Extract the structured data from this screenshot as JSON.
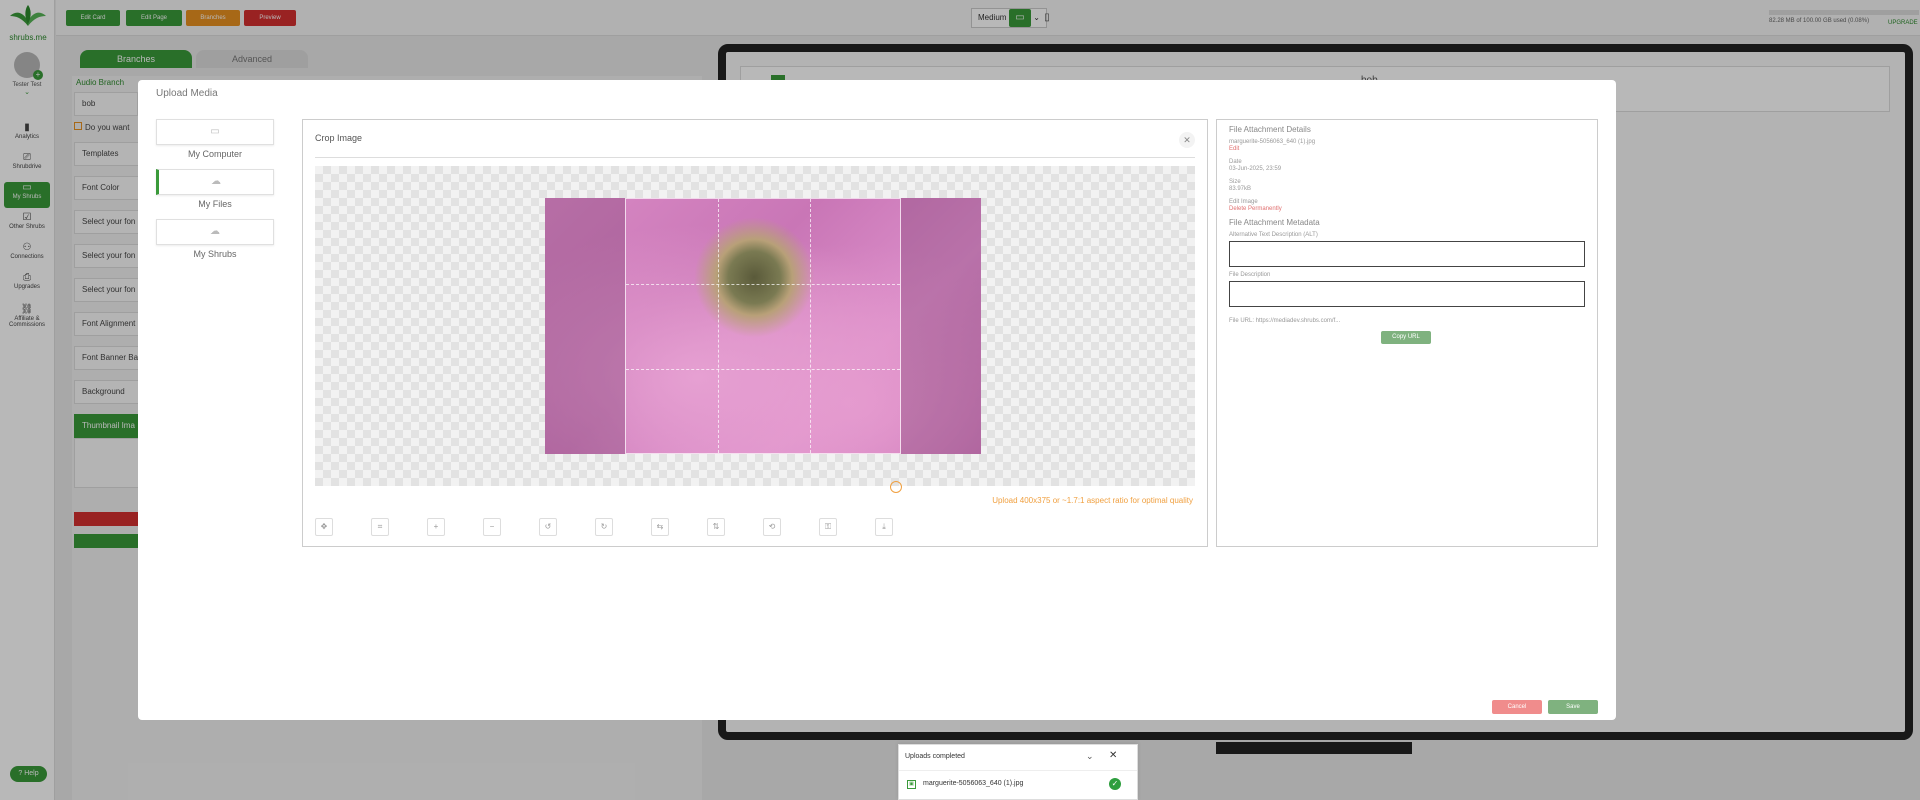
{
  "app": {
    "logo_text": "shrubs.me"
  },
  "sidebar": {
    "user_name": "Tester Test",
    "items": [
      {
        "label": "Analytics",
        "icon": "chart-icon"
      },
      {
        "label": "Shrubdrive",
        "icon": "drive-icon"
      },
      {
        "label": "My Shrubs",
        "icon": "folder-icon"
      },
      {
        "label": "Other Shrubs",
        "icon": "star-icon"
      },
      {
        "label": "Connections",
        "icon": "people-icon"
      },
      {
        "label": "Upgrades",
        "icon": "upgrade-icon"
      },
      {
        "label": "Affiliate & Commissions",
        "icon": "link-icon"
      }
    ],
    "help_label": "Help"
  },
  "toolbar": {
    "buttons": [
      "Edit Card",
      "Edit Page",
      "Branches",
      "Preview"
    ],
    "size_select": "Medium",
    "storage_text": "82.28 MB of 100.00 GB used (0.08%)",
    "upgrade_label": "UPGRADE"
  },
  "editor": {
    "tabs": [
      "Branches",
      "Advanced"
    ],
    "audio_branch_label": "Audio Branch",
    "audio_branch_value": "bob",
    "checkbox_label": "Do you want",
    "rows": [
      "Templates",
      "Font Color",
      "Select your fon",
      "Select your fon",
      "Select your fon",
      "Font Alignment",
      "Font Banner Ba",
      "Background",
      "Thumbnail Ima"
    ]
  },
  "preview": {
    "title": "bob"
  },
  "modal": {
    "title": "Upload Media",
    "sources": [
      {
        "label": "My Computer",
        "icon": "monitor-icon"
      },
      {
        "label": "My Files",
        "icon": "cloud-upload-icon"
      },
      {
        "label": "My Shrubs",
        "icon": "cloud-icon"
      }
    ],
    "crop": {
      "title": "Crop Image",
      "quality_note": "Upload 400x375 or ~1.7:1 aspect ratio for optimal quality",
      "tools": [
        "move-icon",
        "crop-icon",
        "zoom-in-icon",
        "zoom-out-icon",
        "rotate-left-icon",
        "rotate-right-icon",
        "flip-horizontal-icon",
        "flip-vertical-icon",
        "reset-icon",
        "lock-icon",
        "download-icon"
      ]
    },
    "details": {
      "heading": "File Attachment Details",
      "filename": "marguerite-5056063_640 (1).jpg",
      "edit_link": "Edit",
      "date_label": "Date",
      "date_value": "03-Jun-2025, 23:59",
      "size_label": "Size",
      "size_value": "83.97kB",
      "edit_image_label": "Edit Image",
      "delete_link": "Delete Permanently",
      "metadata_heading": "File Attachment Metadata",
      "alt_label": "Alternative Text Description (ALT)",
      "desc_label": "File Description",
      "file_url": "File URL: https://mediadev.shrubs.com/f...",
      "copy_url_label": "Copy URL"
    },
    "cancel_label": "Cancel",
    "save_label": "Save"
  },
  "uploads": {
    "title": "Uploads completed",
    "file": "marguerite-5056063_640 (1).jpg"
  },
  "colors": {
    "brand_green": "#3a9a3a",
    "cancel_red": "#f08c8c",
    "save_green": "#7fb27f",
    "warn_orange": "#f0a040"
  }
}
